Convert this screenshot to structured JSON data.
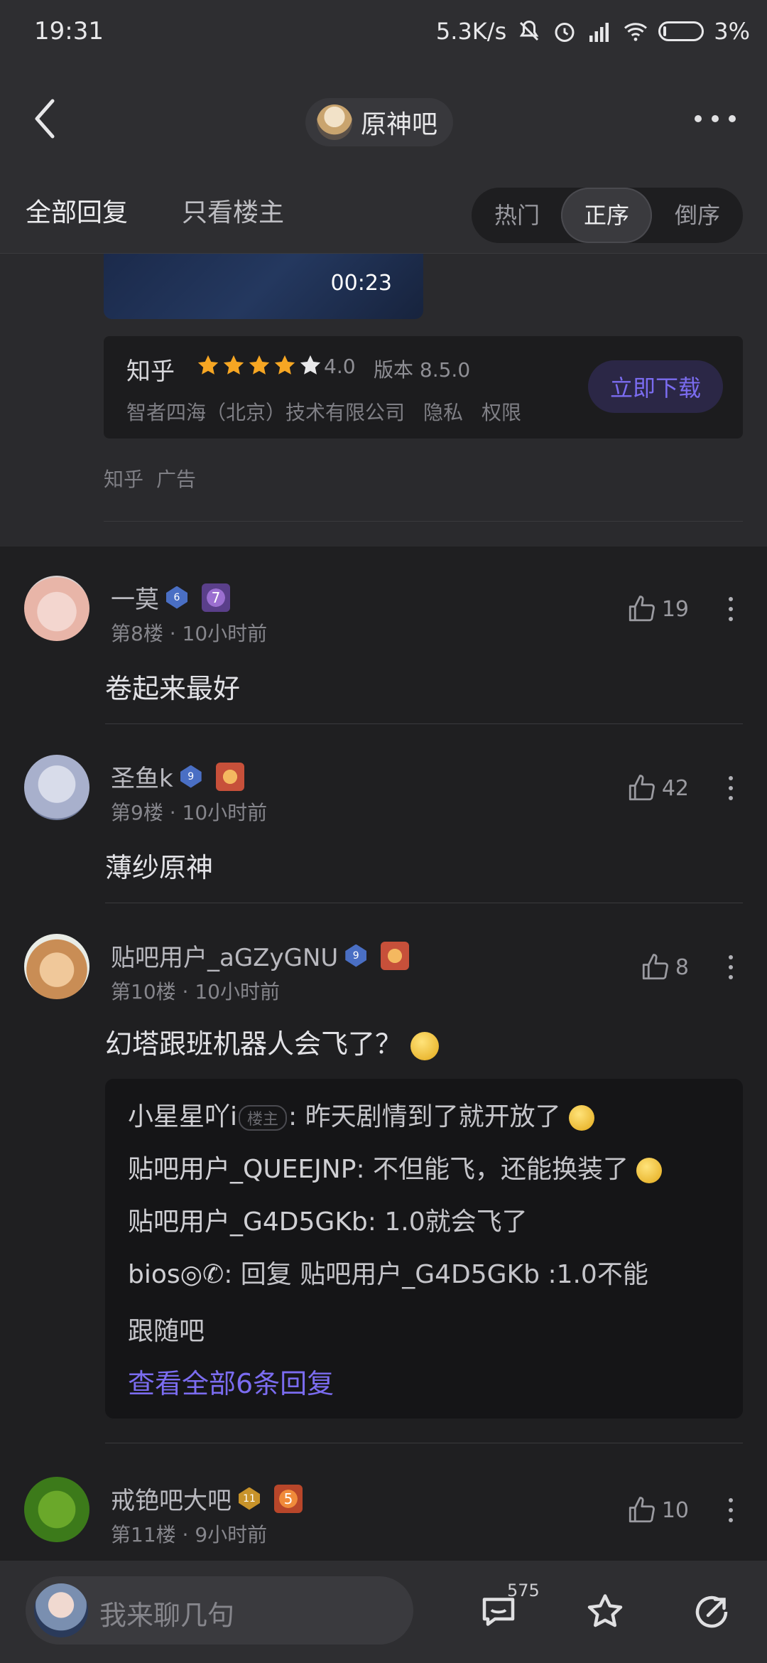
{
  "status_bar": {
    "time": "19:31",
    "speed": "5.3K/s",
    "battery": "3%"
  },
  "nav": {
    "forum_name": "原神吧"
  },
  "tabs": {
    "all": "全部回复",
    "op_only": "只看楼主",
    "sort": [
      "热门",
      "正序",
      "倒序"
    ],
    "sort_selected": "正序"
  },
  "ad": {
    "video_duration": "00:23",
    "app_name": "知乎",
    "rating": "4.0",
    "version": "版本 8.5.0",
    "company": "智者四海（北京）技术有限公司",
    "privacy": "隐私",
    "permissions": "权限",
    "download": "立即下载",
    "source": "知乎",
    "ad_label": "广告"
  },
  "posts": [
    {
      "user": "一莫",
      "level": "6",
      "medal": "7",
      "floor": "第8楼",
      "time": "10小时前",
      "likes": "19",
      "content": "卷起来最好"
    },
    {
      "user": "圣鱼k",
      "level": "9",
      "floor": "第9楼",
      "time": "10小时前",
      "likes": "42",
      "content": "薄纱原神"
    },
    {
      "user": "贴吧用户_aGZyGNU",
      "level": "9",
      "floor": "第10楼",
      "time": "10小时前",
      "likes": "8",
      "content": "幻塔跟班机器人会飞了？"
    },
    {
      "user": "戒铯吧大吧",
      "level": "11",
      "medal": "5",
      "floor": "第11楼",
      "time": "9小时前",
      "likes": "10"
    }
  ],
  "replies": [
    {
      "name": "小星星吖i",
      "op_tag": "楼主",
      "text": ": 昨天剧情到了就开放了"
    },
    {
      "name": "贴吧用户_QUEEJNP",
      "text": ": 不但能飞，还能换装了"
    },
    {
      "name": "贴吧用户_G4D5GKb",
      "text": ": 1.0就会飞了"
    },
    {
      "name": "bios◎✆",
      "text": ": 回复 贴吧用户_G4D5GKb :1.0不能",
      "text2": "跟随吧"
    }
  ],
  "view_all_replies": "查看全部6条回复",
  "bottom": {
    "placeholder": "我来聊几句",
    "comment_count": "575"
  },
  "colors": {
    "accent": "#7b6cf0",
    "background": "#1f1f21",
    "bar": "#2e2e31"
  }
}
